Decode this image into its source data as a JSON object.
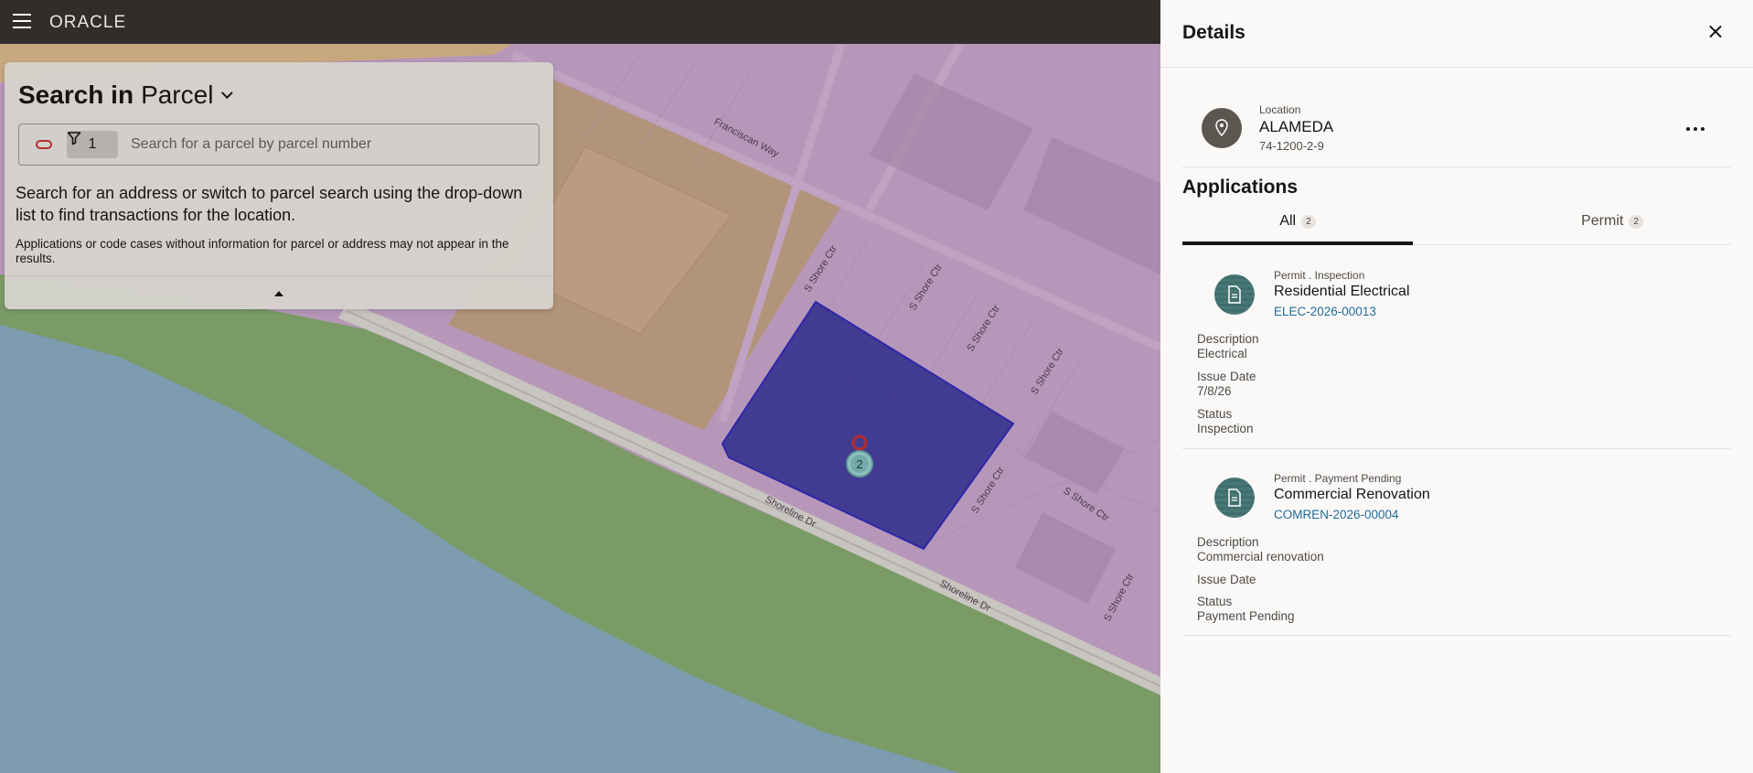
{
  "topbar": {
    "logo_text": "ORACLE"
  },
  "map": {
    "streets": [
      "Franciscan Way",
      "S Shore Ctr",
      "S Shore Ctr",
      "S Shore Ctr",
      "S Shore Ctr",
      "S Shore Ctr",
      "S Shore Ctr",
      "S Shore Ctr",
      "Shoreline Dr",
      "Shoreline Dr"
    ],
    "marker_count": "2",
    "colors": {
      "water": "#7d9cb0",
      "park": "#7a9a66",
      "commercial": "#b2947a",
      "residential": "#b797b9",
      "selected_parcel": "#3c3790",
      "marker": "#b32d2e"
    }
  },
  "search": {
    "title_prefix": "Search in",
    "mode": "Parcel",
    "filter_count": "1",
    "placeholder": "Search for a parcel by parcel number",
    "help_text": "Search for an address or switch to parcel search using the drop-down list to find transactions for the location.",
    "note": "Applications or code cases without information for parcel or address may not appear in the results."
  },
  "drawer": {
    "title": "Details",
    "location": {
      "label": "Location",
      "name": "ALAMEDA",
      "id": "74-1200-2-9"
    },
    "applications_title": "Applications",
    "tabs": [
      {
        "label": "All",
        "count": "2"
      },
      {
        "label": "Permit",
        "count": "2"
      }
    ],
    "applications": [
      {
        "meta": "Permit . Inspection",
        "name": "Residential Electrical",
        "id": "ELEC-2026-00013",
        "description_label": "Description",
        "description": "Electrical",
        "issue_date_label": "Issue Date",
        "issue_date": "7/8/26",
        "status_label": "Status",
        "status": "Inspection"
      },
      {
        "meta": "Permit . Payment Pending",
        "name": "Commercial Renovation",
        "id": "COMREN-2026-00004",
        "description_label": "Description",
        "description": "Commercial renovation",
        "issue_date_label": "Issue Date",
        "issue_date": "",
        "status_label": "Status",
        "status": "Payment Pending"
      }
    ]
  }
}
